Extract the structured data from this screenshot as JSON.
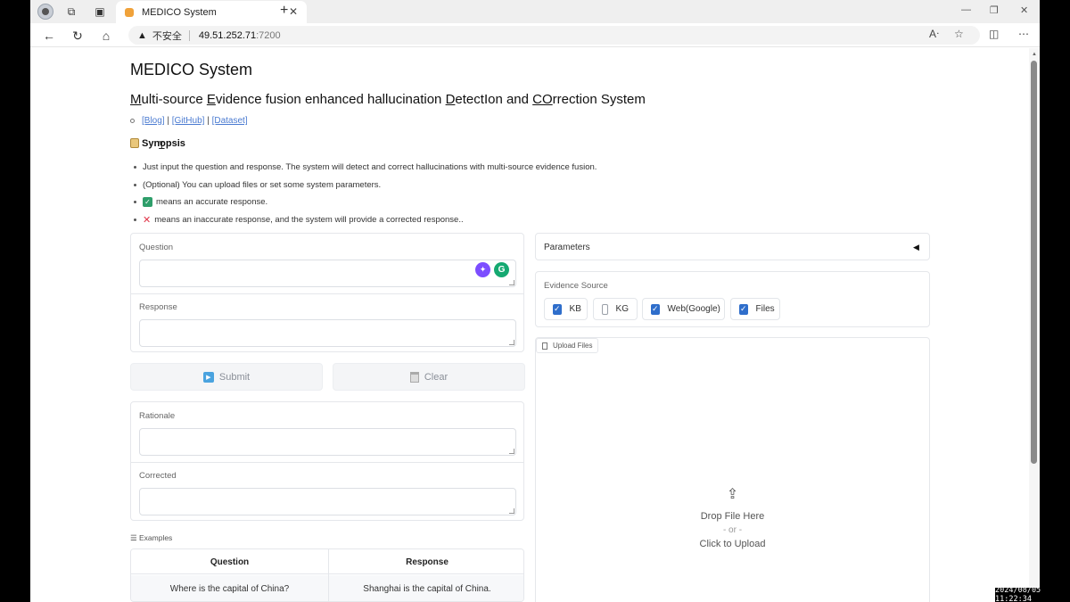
{
  "browser": {
    "tab_title": "MEDICO System",
    "tab_close": "✕",
    "new_tab": "+",
    "security_warning": "不安全",
    "url_host": "49.51.252.71",
    "url_port": ":7200",
    "window_min": "—",
    "window_restore": "❐",
    "window_close": "✕"
  },
  "header": {
    "title": "MEDICO System",
    "subtitle_parts": [
      "M",
      "ulti-source ",
      "E",
      "vidence fusion enhanced hallucination ",
      "D",
      "etectI",
      "on and ",
      "CO",
      "rrection System"
    ]
  },
  "links": {
    "blog": "[Blog]",
    "sep1": " | ",
    "github": "[GitHub]",
    "sep2": " | ",
    "dataset": "[Dataset]"
  },
  "synopsis": {
    "heading": "Synopsis",
    "items": [
      "Just input the question and response. The system will detect and correct hallucinations with multi-source evidence fusion.",
      "(Optional) You can upload files or set some system parameters.",
      "means an accurate response.",
      "means an inaccurate response, and the system will provide a corrected response.."
    ]
  },
  "form": {
    "question_label": "Question",
    "response_label": "Response",
    "submit_label": "Submit",
    "clear_label": "Clear",
    "rationale_label": "Rationale",
    "corrected_label": "Corrected"
  },
  "examples": {
    "label": "Examples",
    "columns": [
      "Question",
      "Response"
    ],
    "rows": [
      [
        "Where is the capital of China?",
        "Shanghai is the capital of China."
      ]
    ]
  },
  "parameters": {
    "title": "Parameters",
    "evidence_label": "Evidence Source",
    "sources": [
      {
        "label": "KB",
        "checked": true
      },
      {
        "label": "KG",
        "checked": false
      },
      {
        "label": "Web(Google)",
        "checked": true
      },
      {
        "label": "Files",
        "checked": true
      }
    ]
  },
  "upload": {
    "tag": "Upload Files",
    "drop_text": "Drop File Here",
    "or_text": "- or -",
    "click_text": "Click to Upload"
  },
  "taskbar": {
    "clock": "2024/08/05 11:22:34"
  },
  "colors": {
    "accent": "#2f6ecb",
    "link": "#4b7bd1",
    "ok": "#2e9e6a",
    "error": "#e0364a"
  }
}
